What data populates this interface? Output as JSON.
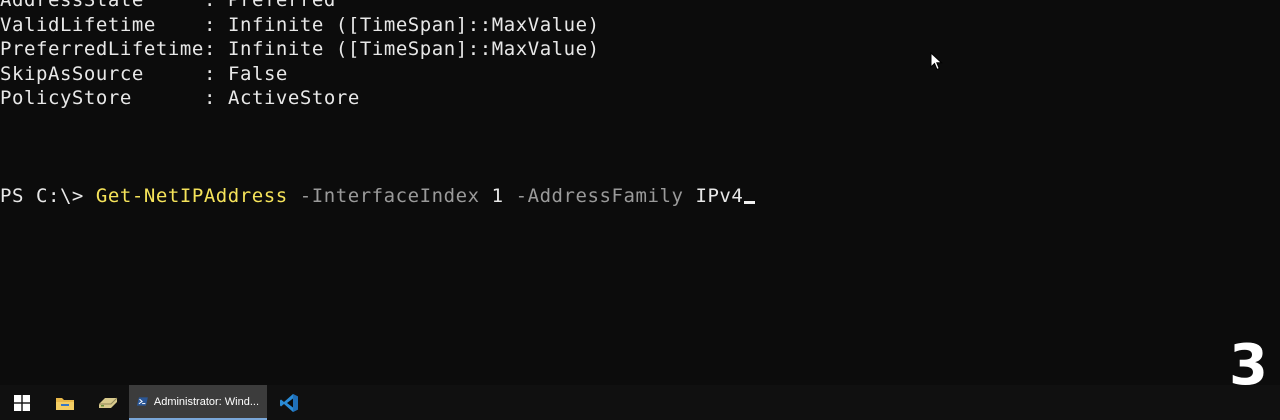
{
  "terminal": {
    "output": [
      {
        "prop": "AddressState",
        "value": ": Preferred"
      },
      {
        "prop": "ValidLifetime",
        "value": ": Infinite ([TimeSpan]::MaxValue)"
      },
      {
        "prop": "PreferredLifetime",
        "value": ": Infinite ([TimeSpan]::MaxValue)"
      },
      {
        "prop": "SkipAsSource",
        "value": ": False"
      },
      {
        "prop": "PolicyStore",
        "value": ": ActiveStore"
      }
    ],
    "prompt": {
      "prefix": "PS C:\\> ",
      "command": "Get-NetIPAddress",
      "param1": "-InterfaceIndex",
      "arg1": "1",
      "param2": "-AddressFamily",
      "arg2": "IPv4"
    }
  },
  "overlay_number": "3",
  "taskbar": {
    "start_icon": "windows-logo-icon",
    "items": [
      {
        "icon": "file-explorer-icon"
      },
      {
        "icon": "network-drive-icon"
      },
      {
        "icon": "powershell-icon",
        "label": "Administrator: Wind..."
      },
      {
        "icon": "vscode-icon"
      }
    ]
  },
  "colors": {
    "background": "#0c0c0c",
    "text": "#e8e8e8",
    "command": "#f5e35a",
    "parameter": "#9a9a9a",
    "powershell_blue": "#2b5797",
    "vscode_blue": "#2a8bd6"
  }
}
